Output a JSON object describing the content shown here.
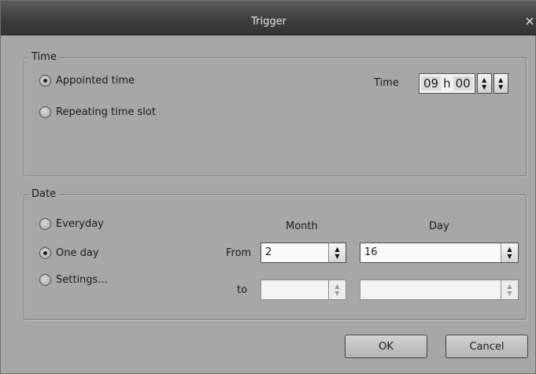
{
  "dialog": {
    "title": "Trigger",
    "close_symbol": "×"
  },
  "time_group": {
    "label": "Time",
    "options": [
      {
        "label": "Appointed time",
        "checked": true
      },
      {
        "label": "Repeating time slot",
        "checked": false
      }
    ],
    "time_label": "Time",
    "hour": "09",
    "hour_unit": "h",
    "minute": "00"
  },
  "date_group": {
    "label": "Date",
    "options": [
      {
        "label": "Everyday",
        "checked": false
      },
      {
        "label": "One day",
        "checked": true
      },
      {
        "label": "Settings...",
        "checked": false
      }
    ],
    "month_header": "Month",
    "day_header": "Day",
    "from_label": "From",
    "to_label": "to",
    "from_month": "2",
    "from_day": "16",
    "to_month": "",
    "to_day": ""
  },
  "buttons": {
    "ok": "OK",
    "cancel": "Cancel"
  },
  "icons": {
    "spin": "up-down-arrows-icon",
    "radio": "radio-button-icon",
    "close": "close-icon"
  }
}
